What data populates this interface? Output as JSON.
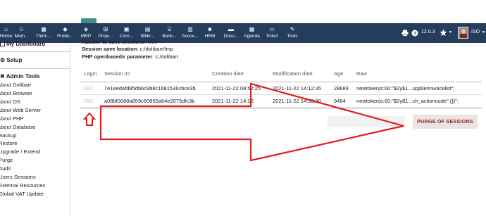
{
  "topbar": {
    "nav_items": [
      {
        "label": "Home",
        "icon": "home-icon"
      },
      {
        "label": "Mem...",
        "icon": "members-icon"
      },
      {
        "label": "Third-...",
        "icon": "building-icon"
      },
      {
        "label": "Produ...",
        "icon": "cube-icon"
      },
      {
        "label": "MRP",
        "icon": "cubes-icon"
      },
      {
        "label": "Proje...",
        "icon": "sitemap-icon"
      },
      {
        "label": "Com...",
        "icon": "suitcase-icon"
      },
      {
        "label": "Billin...",
        "icon": "invoice-icon"
      },
      {
        "label": "Bank...",
        "icon": "bank-icon"
      },
      {
        "label": "Accou...",
        "icon": "accounting-icon"
      },
      {
        "label": "HRM",
        "icon": "user-tie-icon"
      },
      {
        "label": "Docu...",
        "icon": "folder-icon"
      },
      {
        "label": "Agenda",
        "icon": "calendar-icon"
      },
      {
        "label": "Ticket",
        "icon": "ticket-icon"
      },
      {
        "label": "Tools",
        "icon": "wrench-icon"
      }
    ],
    "version": "12.0.3",
    "user": "ISO"
  },
  "sidebar": {
    "my_dashboard": "My Dashboard",
    "setup": "Setup",
    "admin_tools": "Admin Tools",
    "items": [
      "About Dolibarr",
      "About Browser",
      "About OS",
      "About Web Server",
      "About PHP",
      "About Database",
      "Backup",
      "Restore",
      "Upgrade / Extend",
      "Purge",
      "Audit",
      "Users Sessions",
      "External Resources",
      "Global VAT Update"
    ]
  },
  "info": {
    "handler_label": "handler to save sessions",
    "handler_value": "files",
    "location_label": "Session save location",
    "location_value": "c:/dolibarr/tmp",
    "php_label": "PHP openbasedir parameter",
    "php_value": "c:/dolibarr"
  },
  "table": {
    "headers": [
      "Login",
      "Session ID",
      "Creation date",
      "Modification date",
      "Age",
      "Raw"
    ],
    "rows": [
      {
        "login": "ISO",
        "session_id": "7e1eedafd85db6c9b8c1681536cbce3b",
        "created": "2021-11-22 08:52:25",
        "modified": "2021-11-22 14:12:35",
        "age": "28689",
        "raw": "newtoken|s:60:\"$2y$1...upplierinvoicelist\";"
      },
      {
        "login": "ISO",
        "session_id": "a08bf0088a859c60855a64e2075dfc3b",
        "created": "2021-11-22 14:12:",
        "modified": "2021-11-22 14:39:30",
        "age": "9464",
        "raw": "newtoken|s:60:\"$2y$1...ch_actioncode\";{}}\";"
      }
    ]
  },
  "actions": {
    "purge_label": "PURGE OF SESSIONS"
  },
  "colors": {
    "topbar": "#263c5c",
    "annotation": "#e31b1b",
    "purge_text": "#8a1c1c"
  }
}
